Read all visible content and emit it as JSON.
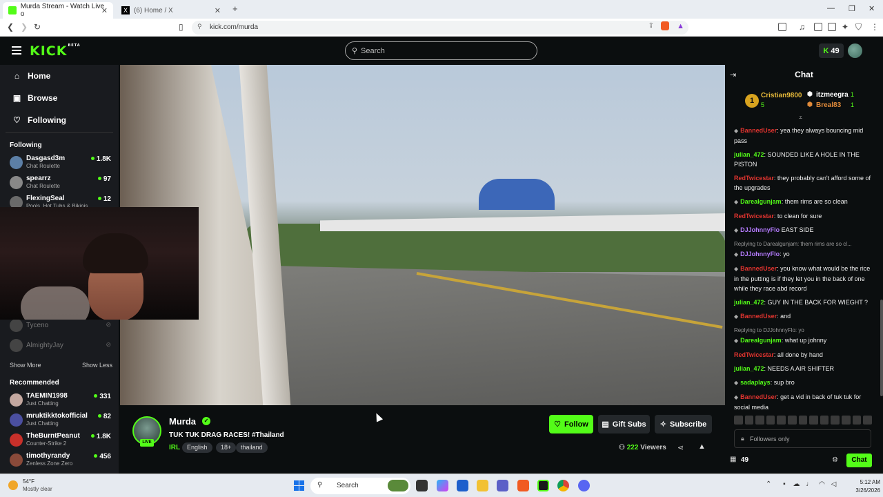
{
  "browser": {
    "tabs": [
      {
        "title": "Murda Stream - Watch Live o",
        "active": true
      },
      {
        "title": "(6) Home / X",
        "active": false
      }
    ],
    "new_tab": "+",
    "url": "kick.com/murda"
  },
  "header": {
    "logo": "KICK",
    "logo_sup": "BETA",
    "search_placeholder": "Search",
    "points": "49"
  },
  "sidebar": {
    "nav": [
      {
        "label": "Home",
        "icon": "home-icon"
      },
      {
        "label": "Browse",
        "icon": "browse-icon"
      },
      {
        "label": "Following",
        "icon": "heart-icon"
      }
    ],
    "following_title": "Following",
    "following": [
      {
        "name": "Dasgasd3m",
        "category": "Chat Roulette",
        "viewers": "1.8K",
        "color": "#5c7fa6"
      },
      {
        "name": "spearrz",
        "category": "Chat Roulette",
        "viewers": "97",
        "color": "#888888"
      },
      {
        "name": "FlexingSeal",
        "category": "Pools, Hot Tubs & Bikinis",
        "viewers": "12",
        "color": "#6a6a6a"
      }
    ],
    "offline": [
      {
        "name": "Tyceno"
      },
      {
        "name": "AlmightyJay"
      }
    ],
    "show_more": "Show More",
    "show_less": "Show Less",
    "recommended_title": "Recommended",
    "recommended": [
      {
        "name": "TAEMIN1998",
        "category": "Just Chatting",
        "viewers": "331",
        "color": "#c4a8a0"
      },
      {
        "name": "mruktikktokofficial",
        "category": "Just Chatting",
        "viewers": "82",
        "color": "#4b4fa0"
      },
      {
        "name": "TheBurntPeanut",
        "category": "Counter-Strike 2",
        "viewers": "1.8K",
        "color": "#c8302a"
      },
      {
        "name": "timothyrandy",
        "category": "Zenless Zone Zero",
        "viewers": "456",
        "color": "#8a4a3a"
      }
    ]
  },
  "stream": {
    "channel": "Murda",
    "live": "LIVE",
    "title": "TUK TUK DRAG RACES!  #Thailand",
    "category": "IRL",
    "tags": [
      "English",
      "18+",
      "thailand"
    ],
    "follow": "Follow",
    "gift": "Gift Subs",
    "subscribe": "Subscribe",
    "viewers": "222",
    "viewers_label": "Viewers"
  },
  "chat": {
    "title": "Chat",
    "leaderboard": [
      {
        "name": "Cristian9800",
        "count": "5",
        "rank": "1"
      },
      {
        "name": "itzmeegra",
        "count": "1"
      },
      {
        "name": "Breal83",
        "count": "1"
      }
    ],
    "messages": [
      {
        "user": "BannedUser",
        "color": "#e0342f",
        "badge": true,
        "text": ": yea they always bouncing mid pass"
      },
      {
        "user": "julian_472",
        "color": "#53fc18",
        "text": ": SOUNDED LIKE A HOLE IN THE PISTON"
      },
      {
        "user": "RedTwicestar",
        "color": "#e0342f",
        "text": ": they probably can't afford some of the upgrades"
      },
      {
        "user": "Darealgunjam",
        "color": "#53fc18",
        "badge": true,
        "text": ": them rims are so clean"
      },
      {
        "user": "RedTwicestar",
        "color": "#e0342f",
        "text": ": to clean for sure"
      },
      {
        "user": "DJJohnnyFlo",
        "color": "#b57cff",
        "badge": true,
        "text": " EAST SIDE"
      },
      {
        "reply": "Replying to Darealgunjam: them rims are so cl...",
        "user": "DJJohnnyFlo",
        "color": "#b57cff",
        "badge": true,
        "text": ": yo"
      },
      {
        "user": "BannedUser",
        "color": "#e0342f",
        "badge": true,
        "text": ": you know what would be the rice in the putting is if they let you in the back of one while they race abd record"
      },
      {
        "user": "julian_472",
        "color": "#53fc18",
        "text": ": GUY IN THE BACK FOR WIEGHT ?"
      },
      {
        "user": "BannedUser",
        "color": "#e0342f",
        "badge": true,
        "text": ": and"
      },
      {
        "reply": "Replying to DJJohnnyFlo: yo",
        "user": "Darealgunjam",
        "color": "#53fc18",
        "badge": true,
        "text": ": what up johnny"
      },
      {
        "user": "RedTwicestar",
        "color": "#e0342f",
        "text": ": all done by hand"
      },
      {
        "user": "julian_472",
        "color": "#53fc18",
        "text": ": NEEDS A AIR SHIFTER"
      },
      {
        "user": "sadaplays",
        "color": "#53fc18",
        "badge": true,
        "text": ": sup bro"
      },
      {
        "user": "BannedUser",
        "color": "#e0342f",
        "badge": true,
        "text": ": get a vid in back of tuk tuk for social media"
      }
    ],
    "input_placeholder": "Followers only",
    "points": "49",
    "send": "Chat"
  },
  "taskbar": {
    "temp": "54°F",
    "weather": "Mostly clear",
    "search": "Search",
    "time": "5:12 AM",
    "date": "3/26/2026"
  }
}
